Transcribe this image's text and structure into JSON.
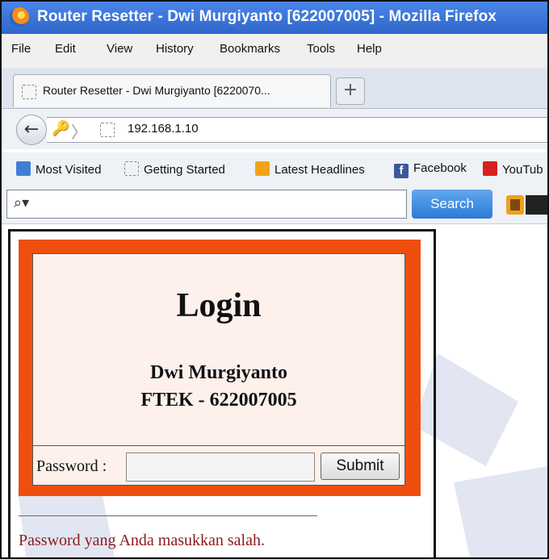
{
  "window": {
    "title": "Router Resetter - Dwi Murgiyanto [622007005] - Mozilla Firefox"
  },
  "menu": [
    "File",
    "Edit",
    "View",
    "History",
    "Bookmarks",
    "Tools",
    "Help"
  ],
  "tab": {
    "label": "Router Resetter - Dwi Murgiyanto [6220070...",
    "new_tab": "+"
  },
  "nav": {
    "url": "192.168.1.10"
  },
  "bookmarks": [
    "Most Visited",
    "Getting Started",
    "Latest Headlines",
    "Facebook",
    "YouTub"
  ],
  "search": {
    "button": "Search"
  },
  "page": {
    "heading": "Login",
    "name": "Dwi Murgiyanto",
    "id_line": "FTEK - 622007005",
    "password_label": "Password :",
    "password_value": "",
    "submit": "Submit",
    "error": "Password yang Anda masukkan salah."
  },
  "colors": {
    "accent": "#ee4f0f",
    "titlebar": "#2f66c9",
    "error": "#8b1a1a"
  },
  "icons": [
    "firefox-logo-icon",
    "back-arrow-icon",
    "key-icon",
    "search-icon",
    "facebook-icon",
    "youtube-icon",
    "rss-icon"
  ]
}
